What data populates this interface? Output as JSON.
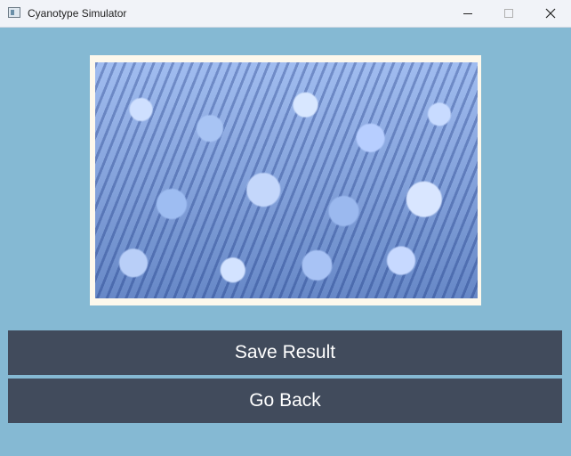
{
  "window": {
    "title": "Cyanotype Simulator",
    "icons": [
      "app-icon",
      "minimize-icon",
      "maximize-icon",
      "close-icon"
    ]
  },
  "image": {
    "subject": "tulip field cyanotype"
  },
  "actions": {
    "save_label": "Save Result",
    "back_label": "Go Back"
  },
  "colors": {
    "background": "#85b9d3",
    "button": "#414b5c",
    "paper": "#fdf8ec"
  }
}
